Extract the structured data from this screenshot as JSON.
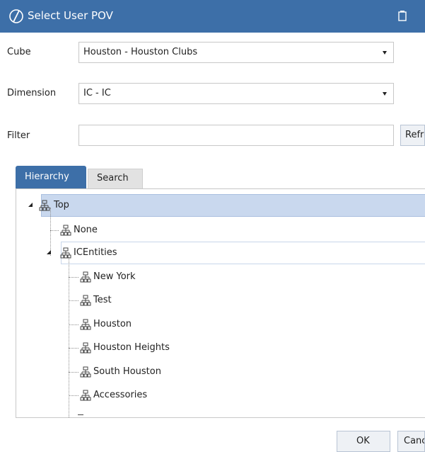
{
  "window": {
    "title": "Select User POV"
  },
  "cube": {
    "label": "Cube",
    "value": "Houston - Houston Clubs"
  },
  "dimension": {
    "label": "Dimension",
    "value": "IC - IC"
  },
  "filter": {
    "label": "Filter",
    "value": "",
    "refresh_label": "Refresh"
  },
  "tabs": [
    {
      "label": "Hierarchy",
      "active": true
    },
    {
      "label": "Search",
      "active": false
    }
  ],
  "tree": {
    "root": "Top",
    "level1": [
      "None",
      "ICEntities"
    ],
    "icentities_children": [
      "New York",
      "Test",
      "Houston",
      "Houston Heights",
      "South Houston",
      "Accessories"
    ]
  },
  "footer": {
    "ok_label": "OK",
    "cancel_label": "Cancel"
  },
  "colors": {
    "accent": "#3d6fa8",
    "selection": "#c9d8ee"
  }
}
